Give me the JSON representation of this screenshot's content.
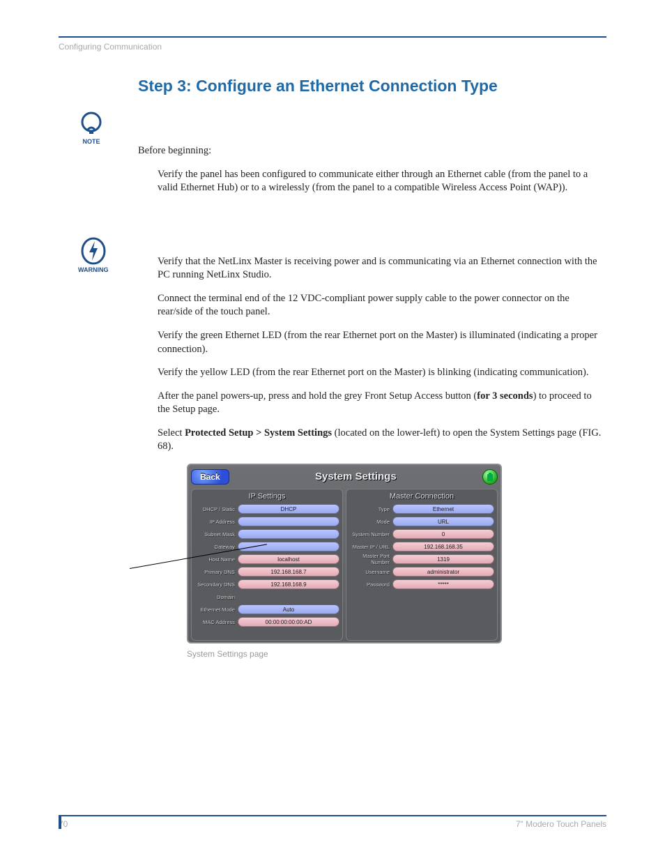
{
  "running_head": "Configuring Communication",
  "heading": "Step 3: Configure an Ethernet Connection Type",
  "icons": {
    "note": "NOTE",
    "warning": "WARNING"
  },
  "before_label": "Before beginning:",
  "verify_panel": "Verify the panel has been configured to communicate either through an Ethernet cable (from the panel to a valid Ethernet Hub) or to a wirelessly (from the panel to a compatible Wireless Access Point (WAP)).",
  "p_netlinx": "Verify that the NetLinx Master is receiving power and is communicating via an Ethernet connection with the PC running NetLinx Studio.",
  "p_connect": "Connect the terminal end of the 12 VDC-compliant power supply cable to the power connector on the rear/side of the touch panel.",
  "p_green": "Verify the green Ethernet LED (from the rear Ethernet port on the Master) is illuminated (indicating a proper connection).",
  "p_yellow": "Verify the yellow LED (from the rear Ethernet port on the Master) is blinking (indicating communication).",
  "p_power_pre": "After the panel powers-up, press and hold the grey Front Setup Access button (",
  "p_power_bold": "for 3 seconds",
  "p_power_post": ") to proceed to the Setup page.",
  "p_select_pre": "Select ",
  "p_select_bold": "Protected Setup > System Settings",
  "p_select_post": " (located on the lower-left) to open the System Settings page (FIG. 68).",
  "shot": {
    "back": "Back",
    "title": "System Settings",
    "left_head": "IP Settings",
    "right_head": "Master Connection",
    "left": {
      "dhcp_l": "DHCP / Static",
      "dhcp_v": "DHCP",
      "ip_l": "IP Address",
      "ip_v": "",
      "mask_l": "Subnet Mask",
      "mask_v": "",
      "gw_l": "Gateway",
      "gw_v": "",
      "host_l": "Host Name",
      "host_v": "localhost",
      "dns1_l": "Primary DNS",
      "dns1_v": "192.168.168.7",
      "dns2_l": "Secondary DNS",
      "dns2_v": "192.168.168.9",
      "dom_l": "Domain",
      "dom_v": "",
      "eth_l": "Ethernet Mode",
      "eth_v": "Auto",
      "mac_l": "MAC Address",
      "mac_v": "00:00:00:00:00:AD"
    },
    "right": {
      "type_l": "Type",
      "type_v": "Ethernet",
      "mode_l": "Mode",
      "mode_v": "URL",
      "sys_l": "System Number",
      "sys_v": "0",
      "mip_l": "Master IP / URL",
      "mip_v": "192.168.168.35",
      "mport_l": "Master Port Number",
      "mport_v": "1319",
      "user_l": "Username",
      "user_v": "administrator",
      "pw_l": "Password",
      "pw_v": "*****"
    }
  },
  "caption": "System Settings page",
  "footer_page": "70",
  "footer_right": "7\" Modero Touch Panels"
}
